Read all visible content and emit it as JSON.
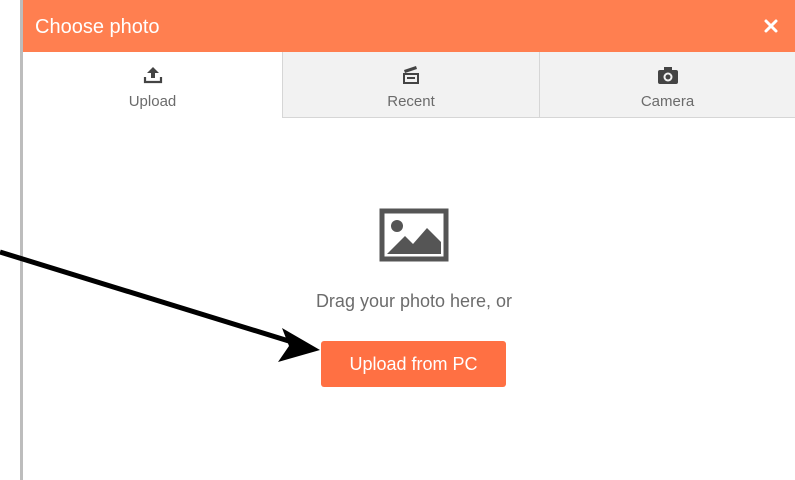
{
  "dialog": {
    "title": "Choose photo",
    "close_icon": "close-icon",
    "accent": "#ff7f50"
  },
  "tabs": [
    {
      "label": "Upload",
      "icon": "upload-icon",
      "active": true
    },
    {
      "label": "Recent",
      "icon": "recent-icon",
      "active": false
    },
    {
      "label": "Camera",
      "icon": "camera-icon",
      "active": false
    }
  ],
  "drop_area": {
    "icon": "image-icon",
    "text": "Drag your photo here, or",
    "button_label": "Upload from PC",
    "button_color": "#ff7043"
  },
  "annotation": {
    "icon": "pointer-arrow",
    "color": "#000000"
  }
}
